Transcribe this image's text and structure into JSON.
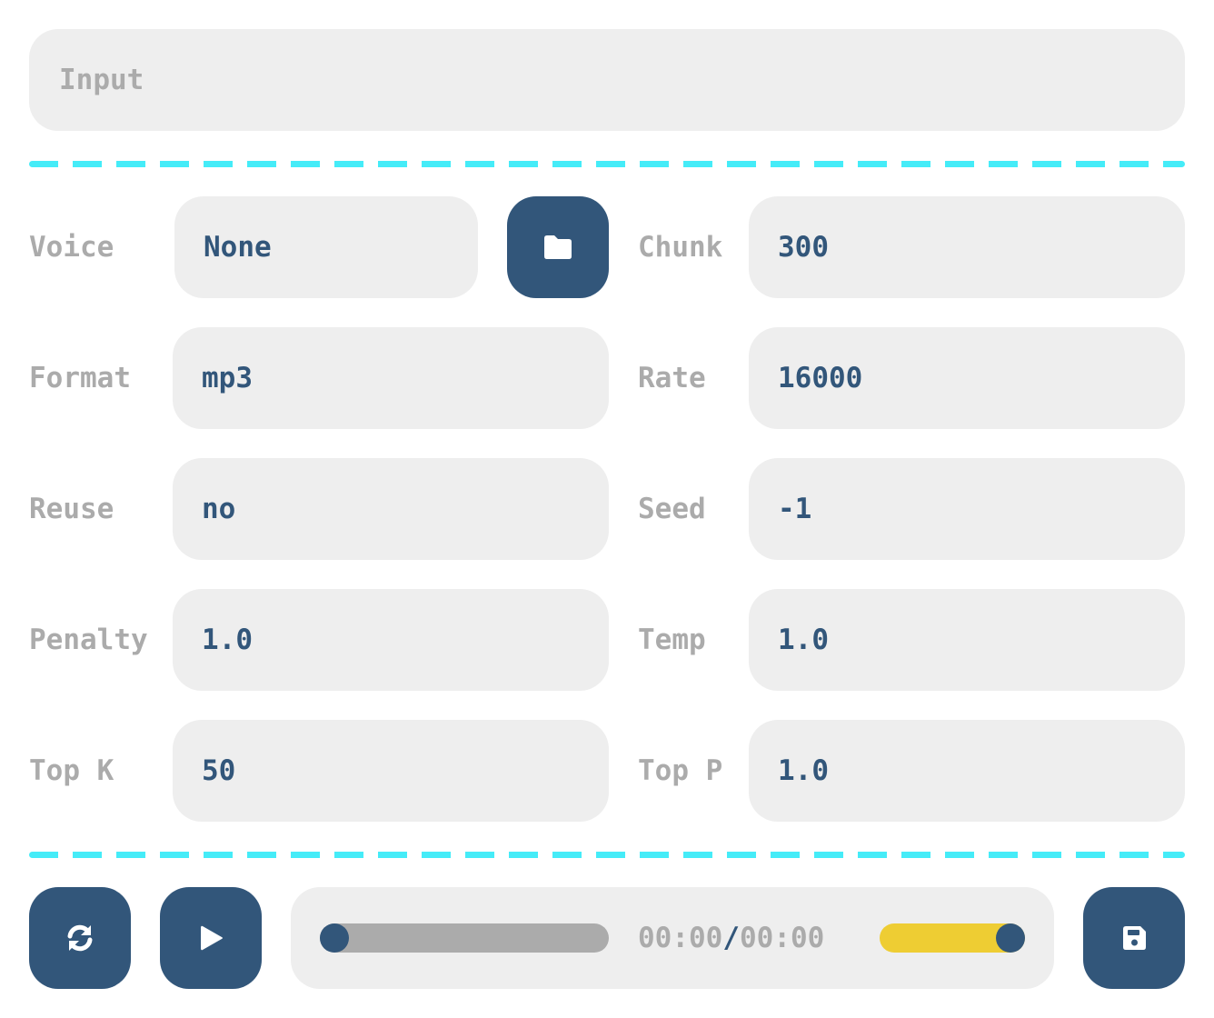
{
  "input": {
    "placeholder": "Input"
  },
  "params": {
    "voice": {
      "label": "Voice",
      "value": "None"
    },
    "chunk": {
      "label": "Chunk",
      "value": "300"
    },
    "format": {
      "label": "Format",
      "value": "mp3"
    },
    "rate": {
      "label": "Rate",
      "value": "16000"
    },
    "reuse": {
      "label": "Reuse",
      "value": "no"
    },
    "seed": {
      "label": "Seed",
      "value": "-1"
    },
    "penalty": {
      "label": "Penalty",
      "value": "1.0"
    },
    "temp": {
      "label": "Temp",
      "value": "1.0"
    },
    "top_k": {
      "label": "Top K",
      "value": "50"
    },
    "top_p": {
      "label": "Top P",
      "value": "1.0"
    }
  },
  "player": {
    "current_time": "00:00",
    "separator": "/",
    "duration": "00:00",
    "progress": 0,
    "volume": 1.0
  },
  "icons": {
    "voice_browse": "folder-icon",
    "refresh": "refresh-icon",
    "play": "play-icon",
    "save": "save-icon"
  },
  "colors": {
    "accent": "#32567a",
    "divider": "#45ecf8",
    "volume": "#eecd33",
    "field_bg": "#eeeeee",
    "muted_text": "#ababab"
  }
}
